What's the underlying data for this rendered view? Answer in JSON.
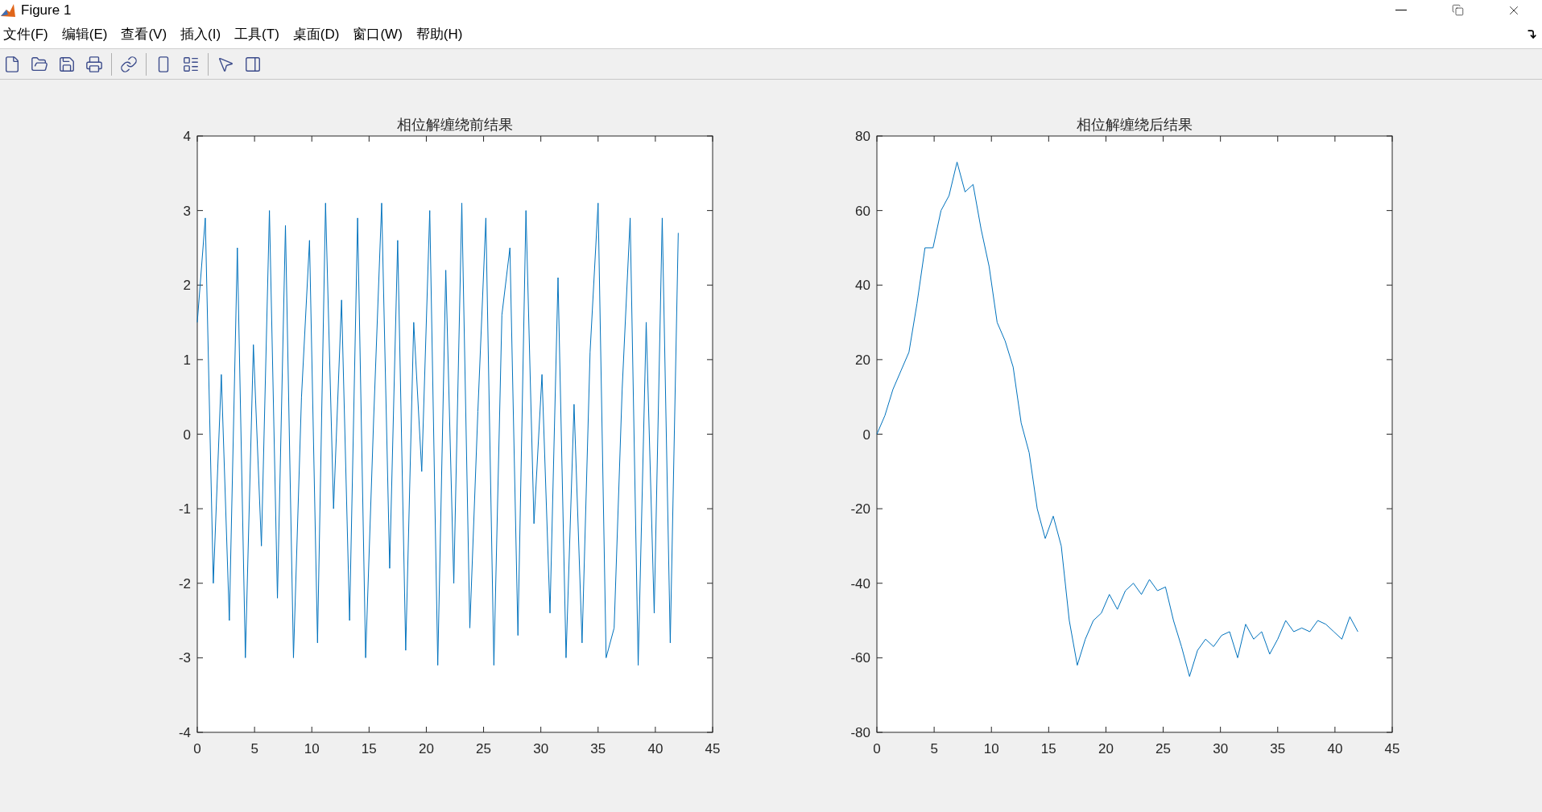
{
  "window": {
    "title": "Figure 1"
  },
  "menu": [
    "文件(F)",
    "编辑(E)",
    "查看(V)",
    "插入(I)",
    "工具(T)",
    "桌面(D)",
    "窗口(W)",
    "帮助(H)"
  ],
  "plots": [
    {
      "chart_data": {
        "type": "line",
        "title": "相位解缠绕前结果",
        "xlim": [
          0,
          45
        ],
        "ylim": [
          -4,
          4
        ],
        "xticks": [
          0,
          5,
          10,
          15,
          20,
          25,
          30,
          35,
          40,
          45
        ],
        "yticks": [
          -4,
          -3,
          -2,
          -1,
          0,
          1,
          2,
          3,
          4
        ],
        "x": [
          0,
          0.7,
          1.4,
          2.1,
          2.8,
          3.5,
          4.2,
          4.9,
          5.6,
          6.3,
          7,
          7.7,
          8.4,
          9.1,
          9.8,
          10.5,
          11.2,
          11.9,
          12.6,
          13.3,
          14,
          14.7,
          15.4,
          16.1,
          16.8,
          17.5,
          18.2,
          18.9,
          19.6,
          20.3,
          21,
          21.7,
          22.4,
          23.1,
          23.8,
          24.5,
          25.2,
          25.9,
          26.6,
          27.3,
          28,
          28.7,
          29.4,
          30.1,
          30.8,
          31.5,
          32.2,
          32.9,
          33.6,
          34.3,
          35,
          35.7,
          36.4,
          37.1,
          37.8,
          38.5,
          39.2,
          39.9,
          40.6,
          41.3,
          42
        ],
        "series": [
          {
            "color": "#0072bd",
            "values": [
              1.5,
              2.9,
              -2,
              0.8,
              -2.5,
              2.5,
              -3,
              1.2,
              -1.5,
              3,
              -2.2,
              2.8,
              -3,
              0.5,
              2.6,
              -2.8,
              3.1,
              -1,
              1.8,
              -2.5,
              2.9,
              -3,
              0.2,
              3.1,
              -1.8,
              2.6,
              -2.9,
              1.5,
              -0.5,
              3.0,
              -3.1,
              2.2,
              -2.0,
              3.1,
              -2.6,
              0.3,
              2.9,
              -3.1,
              1.6,
              2.5,
              -2.7,
              3.0,
              -1.2,
              0.8,
              -2.4,
              2.1,
              -3.0,
              0.4,
              -2.8,
              1.1,
              3.1,
              -3.0,
              -2.6,
              0.6,
              2.9,
              -3.1,
              1.5,
              -2.4,
              2.9,
              -2.8,
              2.7
            ]
          }
        ]
      }
    },
    {
      "chart_data": {
        "type": "line",
        "title": "相位解缠绕后结果",
        "xlim": [
          0,
          45
        ],
        "ylim": [
          -80,
          80
        ],
        "xticks": [
          0,
          5,
          10,
          15,
          20,
          25,
          30,
          35,
          40,
          45
        ],
        "yticks": [
          -80,
          -60,
          -40,
          -20,
          0,
          20,
          40,
          60,
          80
        ],
        "x": [
          0,
          0.7,
          1.4,
          2.1,
          2.8,
          3.5,
          4.2,
          4.9,
          5.6,
          6.3,
          7,
          7.7,
          8.4,
          9.1,
          9.8,
          10.5,
          11.2,
          11.9,
          12.6,
          13.3,
          14,
          14.7,
          15.4,
          16.1,
          16.8,
          17.5,
          18.2,
          18.9,
          19.6,
          20.3,
          21,
          21.7,
          22.4,
          23.1,
          23.8,
          24.5,
          25.2,
          25.9,
          26.6,
          27.3,
          28,
          28.7,
          29.4,
          30.1,
          30.8,
          31.5,
          32.2,
          32.9,
          33.6,
          34.3,
          35,
          35.7,
          36.4,
          37.1,
          37.8,
          38.5,
          39.2,
          39.9,
          40.6,
          41.3,
          42
        ],
        "series": [
          {
            "color": "#0072bd",
            "values": [
              0,
              5,
              12,
              17,
              22,
              35,
              50,
              50,
              60,
              64,
              73,
              65,
              67,
              55,
              45,
              30,
              25,
              18,
              3,
              -5,
              -20,
              -28,
              -22,
              -30,
              -50,
              -62,
              -55,
              -50,
              -48,
              -43,
              -47,
              -42,
              -40,
              -43,
              -39,
              -42,
              -41,
              -50,
              -57,
              -65,
              -58,
              -55,
              -57,
              -54,
              -53,
              -60,
              -51,
              -55,
              -53,
              -59,
              -55,
              -50,
              -53,
              -52,
              -53,
              -50,
              -51,
              -53,
              -55,
              -49,
              -53
            ]
          }
        ]
      }
    }
  ]
}
